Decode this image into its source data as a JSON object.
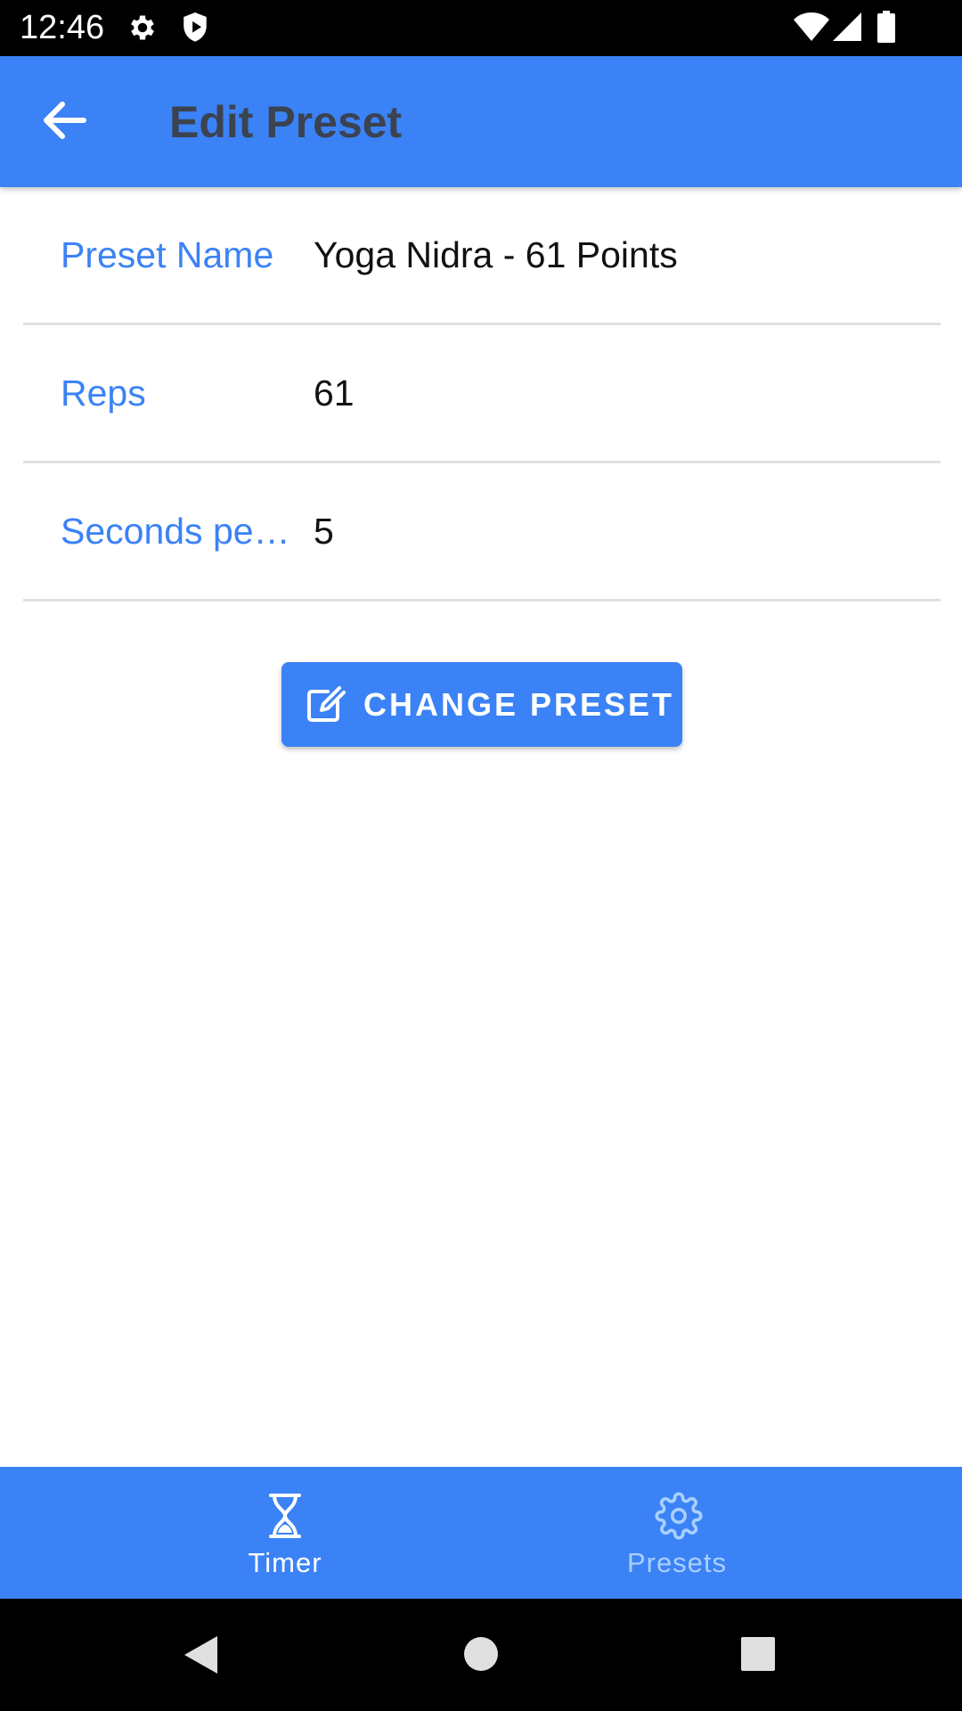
{
  "status_bar": {
    "time": "12:46",
    "icons": [
      "settings-icon",
      "shield-icon",
      "wifi-icon",
      "signal-icon",
      "battery-icon"
    ]
  },
  "app_bar": {
    "title": "Edit Preset",
    "back_icon": "arrow-left-icon"
  },
  "form": {
    "fields": [
      {
        "label": "Preset Name",
        "value": "Yoga Nidra - 61 Points"
      },
      {
        "label": "Seconds per…",
        "value": "5"
      }
    ],
    "reps": {
      "label": "Reps",
      "value": "61"
    }
  },
  "change_button": {
    "label": "CHANGE PRESET",
    "icon": "edit-icon"
  },
  "bottom_nav": {
    "items": [
      {
        "label": "Timer",
        "icon": "hourglass-icon",
        "active": true
      },
      {
        "label": "Presets",
        "icon": "gear-icon",
        "active": false
      }
    ]
  },
  "system_nav": {
    "icons": [
      "back-triangle-icon",
      "home-circle-icon",
      "recents-square-icon"
    ]
  },
  "colors": {
    "accent": "#3b82f6",
    "title_text": "#3b4350",
    "inactive_nav": "#a9d0ff"
  }
}
